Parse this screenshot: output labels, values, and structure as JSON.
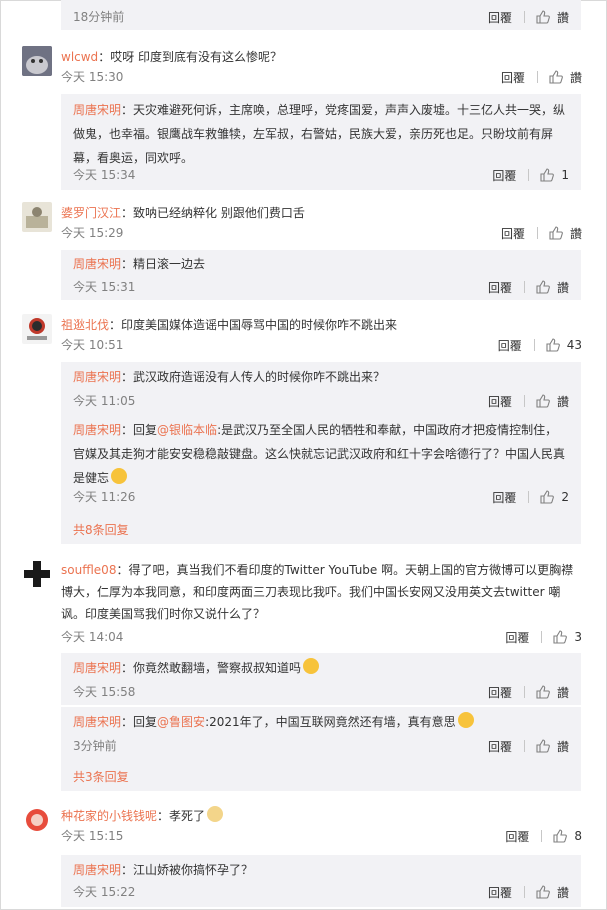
{
  "labels": {
    "reply": "回覆",
    "like": "讚",
    "colon": "：",
    "reply_prefix": "回复",
    "reply_sep": ":"
  },
  "top_reply": {
    "time": "18分钟前"
  },
  "comments": [
    {
      "user": "wlcwd",
      "text": "哎呀 印度到底有没有这么惨呢？",
      "time": "今天 15:30",
      "likes": "讚",
      "replies": [
        {
          "user": "周唐宋明",
          "text": "天灾难避死何诉，主席唤，总理呼，党疼国爱，声声入废墟。十三亿人共一哭，纵做鬼，也幸福。银鹰战车救雏犊，左军叔，右警姑，民族大爱，亲历死也足。只盼坟前有屏幕，看奥运，同欢呼。",
          "time": "今天 15:34",
          "likes": "1"
        }
      ]
    },
    {
      "user": "婆罗门汉江",
      "text": "致呐已经纳粹化 别跟他们费口舌",
      "time": "今天 15:29",
      "likes": "讚",
      "replies": [
        {
          "user": "周唐宋明",
          "text": "精日滚一边去",
          "time": "今天 15:31",
          "likes": "讚"
        }
      ]
    },
    {
      "user": "祖逖北伐",
      "text": "印度美国媒体造谣中国辱骂中国的时候你咋不跳出来",
      "time": "今天 10:51",
      "likes": "43",
      "replies": [
        {
          "user": "周唐宋明",
          "text": "武汉政府造谣没有人传人的时候你咋不跳出来？",
          "time": "今天 11:05",
          "likes": "讚"
        },
        {
          "user": "周唐宋明",
          "mention": "@银临本临",
          "text": "是武汉乃至全国人民的牺牲和奉献，中国政府才把疫情控制住，官媒及其走狗才能安安稳稳敲键盘。这么快就忘记武汉政府和红十字会啥德行了？中国人民真是健忘",
          "emoji": true,
          "time": "今天 11:26",
          "likes": "2"
        }
      ],
      "more": "共8条回复"
    },
    {
      "user": "souffle08",
      "text": "得了吧，真当我们不看印度的Twitter YouTube 啊。天朝上国的官方微博可以更胸襟博大，仁厚为本我同意，和印度两面三刀表现比我吓。我们中国长安网又没用英文去twitter 嘲讽。印度美国骂我们时你又说什么了？",
      "time": "今天 14:04",
      "likes": "3",
      "replies": [
        {
          "user": "周唐宋明",
          "text": "你竟然敢翻墙，警察叔叔知道吗",
          "emoji": true,
          "time": "今天 15:58",
          "likes": "讚"
        },
        {
          "user": "周唐宋明",
          "mention": "@鲁图安",
          "text": "2021年了，中国互联网竟然还有墙，真有意思",
          "emoji": true,
          "time": "3分钟前",
          "likes": "讚"
        }
      ],
      "more": "共3条回复"
    },
    {
      "user": "种花家的小钱钱呢",
      "text": "孝死了",
      "emoji": true,
      "time": "今天 15:15",
      "likes": "8",
      "replies": [
        {
          "user": "周唐宋明",
          "text": "江山娇被你搞怀孕了？",
          "time": "今天 15:22",
          "likes": "讚"
        }
      ]
    }
  ]
}
